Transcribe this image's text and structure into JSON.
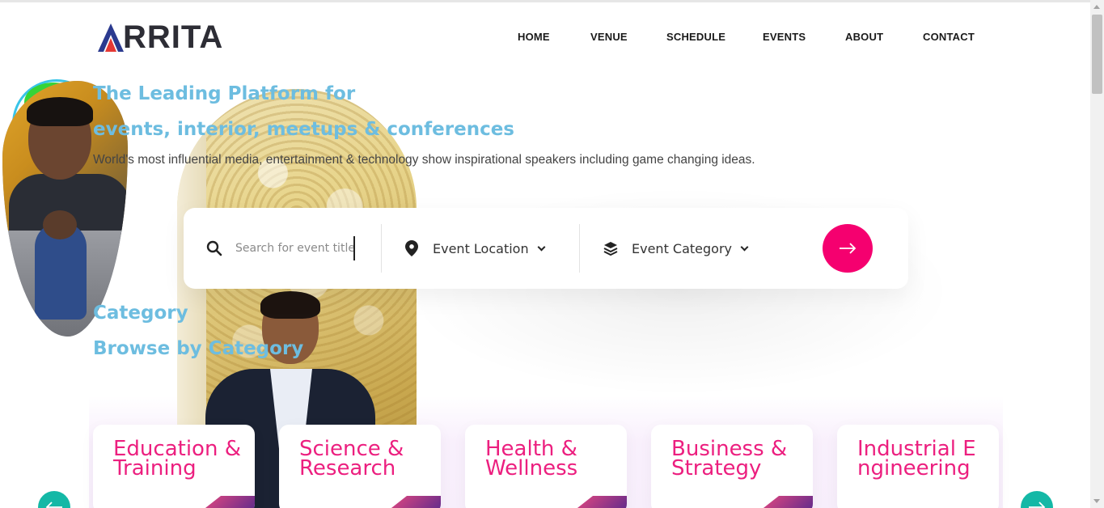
{
  "brand": {
    "logo_text": "RRITA",
    "logo_initial": "A"
  },
  "nav": {
    "items": [
      {
        "label": "HOME"
      },
      {
        "label": "VENUE"
      },
      {
        "label": "SCHEDULE"
      },
      {
        "label": "EVENTS"
      },
      {
        "label": "ABOUT"
      },
      {
        "label": "CONTACT"
      }
    ]
  },
  "hero": {
    "title_line1": "The Leading Platform for",
    "title_line2": "events, interior, meetups & conferences",
    "subtitle": "World's most influential media, entertainment & technology show inspirational speakers including game changing ideas."
  },
  "search": {
    "placeholder": "Search for event title",
    "location_label": "Event Location",
    "category_label": "Event Category",
    "search_icon": "search-icon",
    "location_icon": "map-pin-icon",
    "category_icon": "layers-icon",
    "submit_icon": "arrow-right-icon"
  },
  "categories": {
    "label": "Category",
    "title": "Browse by Category",
    "items": [
      {
        "title": "Education & Training"
      },
      {
        "title": "Science & Research"
      },
      {
        "title": "Health & Wellness"
      },
      {
        "title": "Business & Strategy"
      },
      {
        "title": "Industrial Engineering"
      }
    ]
  },
  "colors": {
    "accent_pink": "#f5006f",
    "heading_blue": "#6dbde0",
    "card_title_pink": "#ec1f7f",
    "carousel_teal": "#14b8a6"
  }
}
